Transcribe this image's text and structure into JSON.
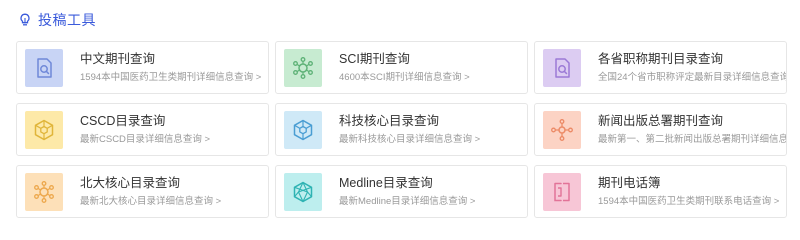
{
  "section": {
    "title": "投稿工具",
    "icon": "lightbulb-icon"
  },
  "cards": [
    {
      "name": "chinese-journal-query",
      "title": "中文期刊查询",
      "desc": "1594本中国医药卫生类期刊详细信息查询 >",
      "icon": "document-search-icon",
      "bg": "#c8d4f5",
      "fg": "#6f88d8"
    },
    {
      "name": "sci-journal-query",
      "title": "SCI期刊查询",
      "desc": "4600本SCI期刊详细信息查询 >",
      "icon": "molecule-icon",
      "bg": "#c7ebd1",
      "fg": "#5eb277"
    },
    {
      "name": "provincial-title-journal-query",
      "title": "各省职称期刊目录查询",
      "desc": "全国24个省市职称评定最新目录详细信息查询 >",
      "icon": "document-search-icon",
      "bg": "#dcccf2",
      "fg": "#9b7ad6"
    },
    {
      "name": "cscd-catalog-query",
      "title": "CSCD目录查询",
      "desc": "最新CSCD目录详细信息查询 >",
      "icon": "cube-icon",
      "bg": "#fde9a8",
      "fg": "#e0b53a"
    },
    {
      "name": "tech-core-catalog-query",
      "title": "科技核心目录查询",
      "desc": "最新科技核心目录详细信息查询 >",
      "icon": "cube-icon",
      "bg": "#cfe9f7",
      "fg": "#4a9ed3"
    },
    {
      "name": "press-publication-journal-query",
      "title": "新闻出版总署期刊查询",
      "desc": "最新第一、第二批新闻出版总署期刊详细信息查询 >",
      "icon": "network-icon",
      "bg": "#fcd3c4",
      "fg": "#ec8a66"
    },
    {
      "name": "pku-core-catalog-query",
      "title": "北大核心目录查询",
      "desc": "最新北大核心目录详细信息查询 >",
      "icon": "molecule-icon",
      "bg": "#fde0b8",
      "fg": "#eda84d"
    },
    {
      "name": "medline-catalog-query",
      "title": "Medline目录查询",
      "desc": "最新Medline目录详细信息查询 >",
      "icon": "crystal-icon",
      "bg": "#bdeeee",
      "fg": "#2fb3b3"
    },
    {
      "name": "journal-phonebook",
      "title": "期刊电话簿",
      "desc": "1594本中国医药卫生类期刊联系电话查询 >",
      "icon": "phonebook-icon",
      "bg": "#f7c6d6",
      "fg": "#e27398"
    }
  ]
}
